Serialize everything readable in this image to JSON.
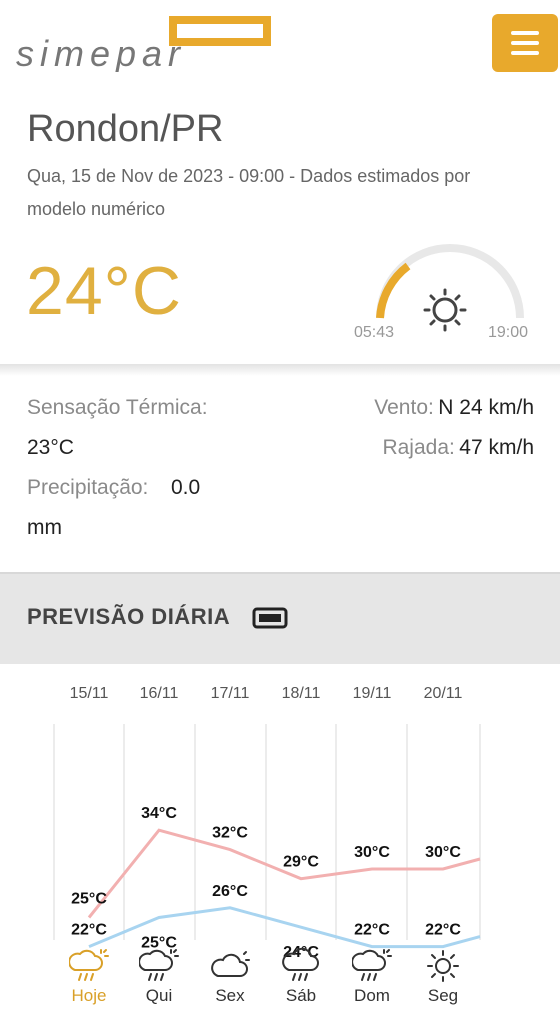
{
  "header": {
    "logo_text": "simepar",
    "menu_icon": "hamburger-icon"
  },
  "current": {
    "city": "Rondon/PR",
    "subtitle": "Qua, 15 de Nov de 2023 - 09:00 - Dados estimados por modelo numérico",
    "temperature": "24°C",
    "sunrise": "05:43",
    "sunset": "19:00",
    "sun_icon": "sun-icon",
    "accent_color": "#e0b040"
  },
  "details": {
    "sensacao_label": "Sensação Térmica:",
    "sensacao_value": "23°C",
    "precipitacao_label": "Precipitação:",
    "precipitacao_value": "0.0",
    "precipitacao_unit": "mm",
    "vento_label": "Vento:",
    "vento_value": "N 24 km/h",
    "rajada_label": "Rajada:",
    "rajada_value": "47 km/h"
  },
  "forecast": {
    "title": "PREVISÃO DIÁRIA",
    "max_color": "#f2b0b0",
    "min_color": "#a8d4f0",
    "days": [
      {
        "date": "15/11",
        "name": "Hoje",
        "max": "25°C",
        "min": "22°C",
        "icon": "rain-sun-cloud-icon"
      },
      {
        "date": "16/11",
        "name": "Qui",
        "max": "34°C",
        "min": "25°C",
        "icon": "rain-sun-cloud-icon"
      },
      {
        "date": "17/11",
        "name": "Sex",
        "max": "32°C",
        "min": "26°C",
        "icon": "partly-cloudy-icon"
      },
      {
        "date": "18/11",
        "name": "Sáb",
        "max": "29°C",
        "min": "24°C",
        "icon": "rain-cloud-icon"
      },
      {
        "date": "19/11",
        "name": "Dom",
        "max": "30°C",
        "min": "22°C",
        "icon": "rain-sun-cloud-icon"
      },
      {
        "date": "20/11",
        "name": "Seg",
        "max": "30°C",
        "min": "22°C",
        "icon": "sun-icon"
      }
    ]
  }
}
